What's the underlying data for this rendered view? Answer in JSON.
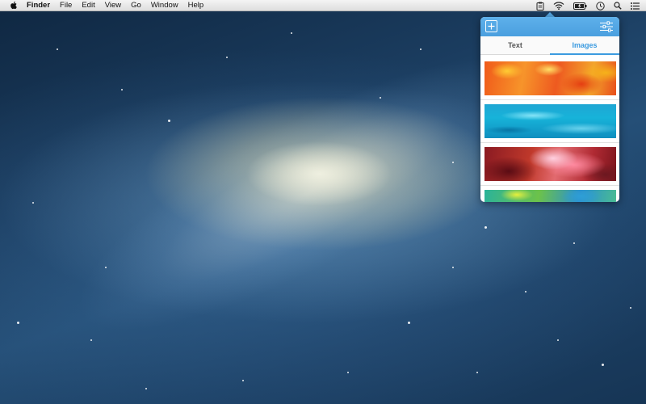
{
  "menubar": {
    "app_name": "Finder",
    "menus": [
      "File",
      "Edit",
      "View",
      "Go",
      "Window",
      "Help"
    ]
  },
  "status_icons": [
    "clipboard-icon",
    "wifi-icon",
    "battery-icon",
    "time-machine-icon",
    "spotlight-search-icon",
    "notification-center-icon"
  ],
  "popover": {
    "tabs": [
      {
        "label": "Text",
        "active": false
      },
      {
        "label": "Images",
        "active": true
      }
    ],
    "images": [
      {
        "name": "orange-abstract-painting"
      },
      {
        "name": "turquoise-water"
      },
      {
        "name": "antelope-canyon"
      },
      {
        "name": "green-abstract"
      }
    ]
  },
  "colors": {
    "accent": "#4a9fdf",
    "active_tab": "#3c9be0"
  }
}
